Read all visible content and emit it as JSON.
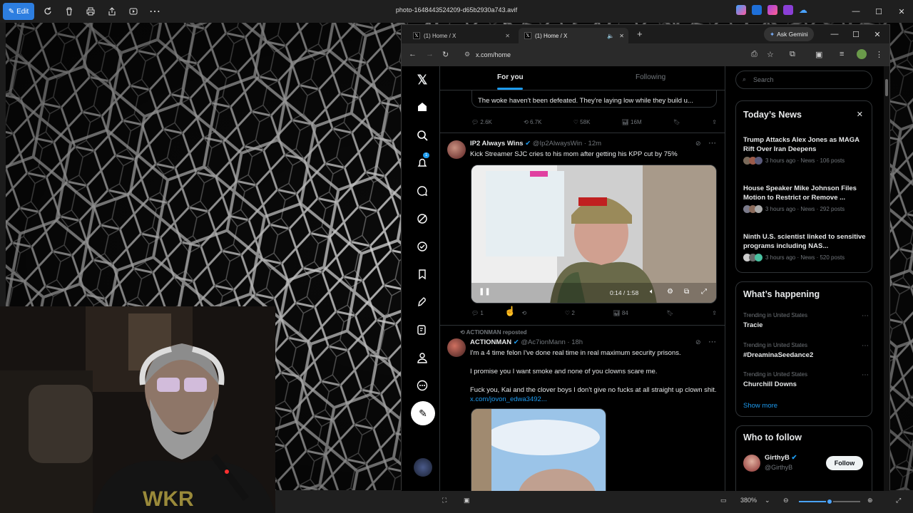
{
  "photos": {
    "title": "photo-1648443524209-d65b2930a743.avif",
    "edit_label": "Edit",
    "zoom": "380%"
  },
  "browser": {
    "tabs": [
      {
        "label": "(1) Home / X"
      },
      {
        "label": "(1) Home / X"
      }
    ],
    "ask_gemini": "Ask Gemini",
    "url": "x.com/home"
  },
  "x": {
    "tabs": {
      "for_you": "For you",
      "following": "Following"
    },
    "notif_count": "1",
    "prev_tweet": {
      "text": "The woke haven't been defeated. They're laying low while they build u...",
      "replies": "2.6K",
      "reposts": "6.7K",
      "likes": "58K",
      "views": "16M"
    },
    "tweet1": {
      "name": "IP2 Always Wins",
      "handle": "@Ip2AlwaysWin",
      "time": "· 12m",
      "text": "Kick Streamer SJC cries to his mom after getting his KPP cut by 75%",
      "video_time": "0:14 / 1:58",
      "replies": "1",
      "reposts": "",
      "likes": "2",
      "views": "84"
    },
    "tweet2": {
      "repost_label": "ACTIONMAN reposted",
      "name": "ACTIONMAN",
      "handle": "@Ac7ionMann",
      "time": "· 18h",
      "p1": "I'm a 4 time felon I've done real time in real maximum security prisons.",
      "p2": "I promise you I want smoke and none of you clowns scare me.",
      "p3": "Fuck you, Kai and the clover boys I don't give no fucks at all straight up clown shit.",
      "link": "x.com/jovon_edwa3492..."
    },
    "search_placeholder": "Search",
    "news": {
      "title": "Today’s News",
      "items": [
        {
          "headline": "Trump Attacks Alex Jones as MAGA Rift Over Iran Deepens",
          "meta": "3 hours ago · News · 106 posts"
        },
        {
          "headline": "House Speaker Mike Johnson Files Motion to Restrict or Remove ...",
          "meta": "3 hours ago · News · 292 posts"
        },
        {
          "headline": "Ninth U.S. scientist linked to sensitive programs including NAS...",
          "meta": "3 hours ago · News · 520 posts"
        }
      ]
    },
    "happening": {
      "title": "What’s happening",
      "items": [
        {
          "context": "Trending in United States",
          "topic": "Tracie"
        },
        {
          "context": "Trending in United States",
          "topic": "#DreaminaSeedance2"
        },
        {
          "context": "Trending in United States",
          "topic": "Churchill Downs"
        }
      ],
      "show_more": "Show more"
    },
    "follow": {
      "title": "Who to follow",
      "name": "GirthyB",
      "handle": "@GirthyB",
      "button": "Follow"
    }
  }
}
